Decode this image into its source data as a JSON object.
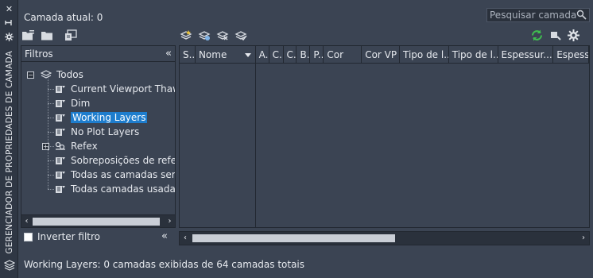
{
  "sidebar": {
    "title": "GERENCIADOR DE PROPRIEDADES DE CAMADA",
    "close_icon": "close-icon",
    "pin_icon": "pin-icon",
    "settings_icon": "settings-icon"
  },
  "header": {
    "current_layer": "Camada atual: 0",
    "search_placeholder": "Pesquisar camada"
  },
  "filters": {
    "header": "Filtros",
    "tree": [
      {
        "label": "Todos",
        "level": 0,
        "expander": "−"
      },
      {
        "label": "Current Viewport Thawed",
        "level": 1
      },
      {
        "label": "Dim",
        "level": 1
      },
      {
        "label": "Working Layers",
        "level": 1,
        "selected": true
      },
      {
        "label": "No Plot Layers",
        "level": 1
      },
      {
        "label": "Refex",
        "level": 1,
        "expander": "+"
      },
      {
        "label": "Sobreposições de refex",
        "level": 1
      },
      {
        "label": "Todas as camadas sem Xr",
        "level": 1
      },
      {
        "label": "Todas camadas usadas",
        "level": 1
      }
    ],
    "invert_label": "Inverter filtro"
  },
  "grid": {
    "columns": [
      "S..",
      "Nome",
      "A..",
      "C..",
      "C..",
      "B..",
      "P..",
      "Cor",
      "Cor VP",
      "Tipo de l...",
      "Tipo de l...",
      "Espessur...",
      "Espess"
    ]
  },
  "status": "Working Layers: 0 camadas exibidas de 64 camadas totais",
  "colors": {
    "background": "#3b4453",
    "selection": "#1e7dcd",
    "refresh_icon": "#3fbf4f"
  }
}
